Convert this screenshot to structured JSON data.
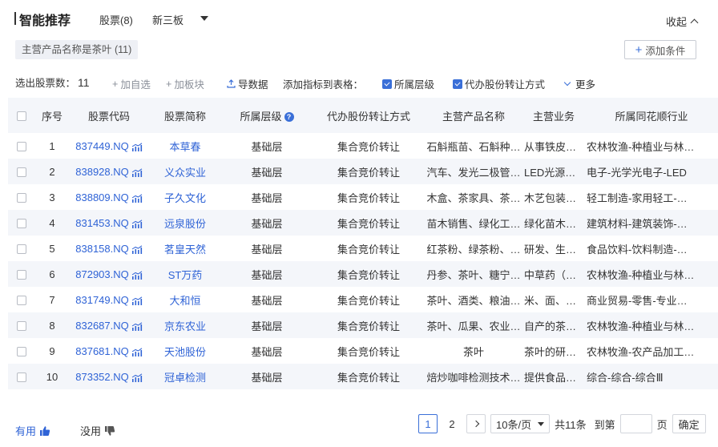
{
  "header": {
    "title": "智能推荐",
    "tabs": [
      {
        "label": "股票(8)"
      },
      {
        "label": "新三板"
      }
    ],
    "collapse_label": "收起"
  },
  "conditions": {
    "tag": "主营产品名称是茶叶 (11)",
    "add_label": "添加条件"
  },
  "toolbar": {
    "selected_label": "选出股票数：",
    "selected_count": "11",
    "add_watch": "加自选",
    "add_board": "加板块",
    "export": "导数据",
    "add_indicator_label": "添加指标到表格：",
    "checks": [
      {
        "label": "所属层级"
      },
      {
        "label": "代办股份转让方式"
      }
    ],
    "more": "更多"
  },
  "table": {
    "columns": [
      "序号",
      "股票代码",
      "股票简称",
      "所属层级",
      "代办股份转让方式",
      "主营产品名称",
      "主营业务",
      "所属同花顺行业"
    ],
    "rows": [
      {
        "idx": "1",
        "code": "837449.NQ",
        "name": "本草春",
        "level": "基础层",
        "method": "集合竞价转让",
        "product": "石斛瓶苗、石斛种…",
        "business": "从事铁皮石斛…",
        "industry": "农林牧渔-种植业与林…"
      },
      {
        "idx": "2",
        "code": "838928.NQ",
        "name": "义众实业",
        "level": "基础层",
        "method": "集合竞价转让",
        "product": "汽车、发光二极管…",
        "business": "LED光源器件…",
        "industry": "电子-光学光电子-LED"
      },
      {
        "idx": "3",
        "code": "838809.NQ",
        "name": "子久文化",
        "level": "基础层",
        "method": "集合竞价转让",
        "product": "木盒、茶家具、茶…",
        "business": "木艺包装盒及…",
        "industry": "轻工制造-家用轻工-…"
      },
      {
        "idx": "4",
        "code": "831453.NQ",
        "name": "远泉股份",
        "level": "基础层",
        "method": "集合竞价转让",
        "product": "苗木销售、绿化工…",
        "business": "绿化苗木种植…",
        "industry": "建筑材料-建筑装饰-…"
      },
      {
        "idx": "5",
        "code": "838158.NQ",
        "name": "茗皇天然",
        "level": "基础层",
        "method": "集合竞价转让",
        "product": "红茶粉、绿茶粉、…",
        "business": "研发、生产和…",
        "industry": "食品饮料-饮料制造-…"
      },
      {
        "idx": "6",
        "code": "872903.NQ",
        "name": "ST万药",
        "level": "基础层",
        "method": "集合竞价转让",
        "product": "丹参、茶叶、糖宁…",
        "business": "中草药（丹参…",
        "industry": "农林牧渔-种植业与林…"
      },
      {
        "idx": "7",
        "code": "831749.NQ",
        "name": "大和恒",
        "level": "基础层",
        "method": "集合竞价转让",
        "product": "茶叶、酒类、粮油…",
        "business": "米、面、粮、…",
        "industry": "商业贸易-零售-专业…"
      },
      {
        "idx": "8",
        "code": "832687.NQ",
        "name": "京东农业",
        "level": "基础层",
        "method": "集合竞价转让",
        "product": "茶叶、瓜果、农业…",
        "business": "自产的茶叶、…",
        "industry": "农林牧渔-种植业与林…"
      },
      {
        "idx": "9",
        "code": "837681.NQ",
        "name": "天池股份",
        "level": "基础层",
        "method": "集合竞价转让",
        "product": "茶叶",
        "business": "茶叶的研发、…",
        "industry": "农林牧渔-农产品加工…"
      },
      {
        "idx": "10",
        "code": "873352.NQ",
        "name": "冠卓检测",
        "level": "基础层",
        "method": "集合竞价转让",
        "product": "焙炒咖啡检测技术…",
        "business": "提供食品类及…",
        "industry": "综合-综合-综合Ⅲ"
      }
    ]
  },
  "footer": {
    "useful": "有用",
    "useless": "没用",
    "pages": [
      "1",
      "2"
    ],
    "page_size": "10条/页",
    "total": "共11条",
    "goto_label": "到第",
    "page_unit": "页",
    "confirm": "确定"
  },
  "colors": {
    "accent": "#2f63d6",
    "header_bg": "#f4f6fa"
  }
}
